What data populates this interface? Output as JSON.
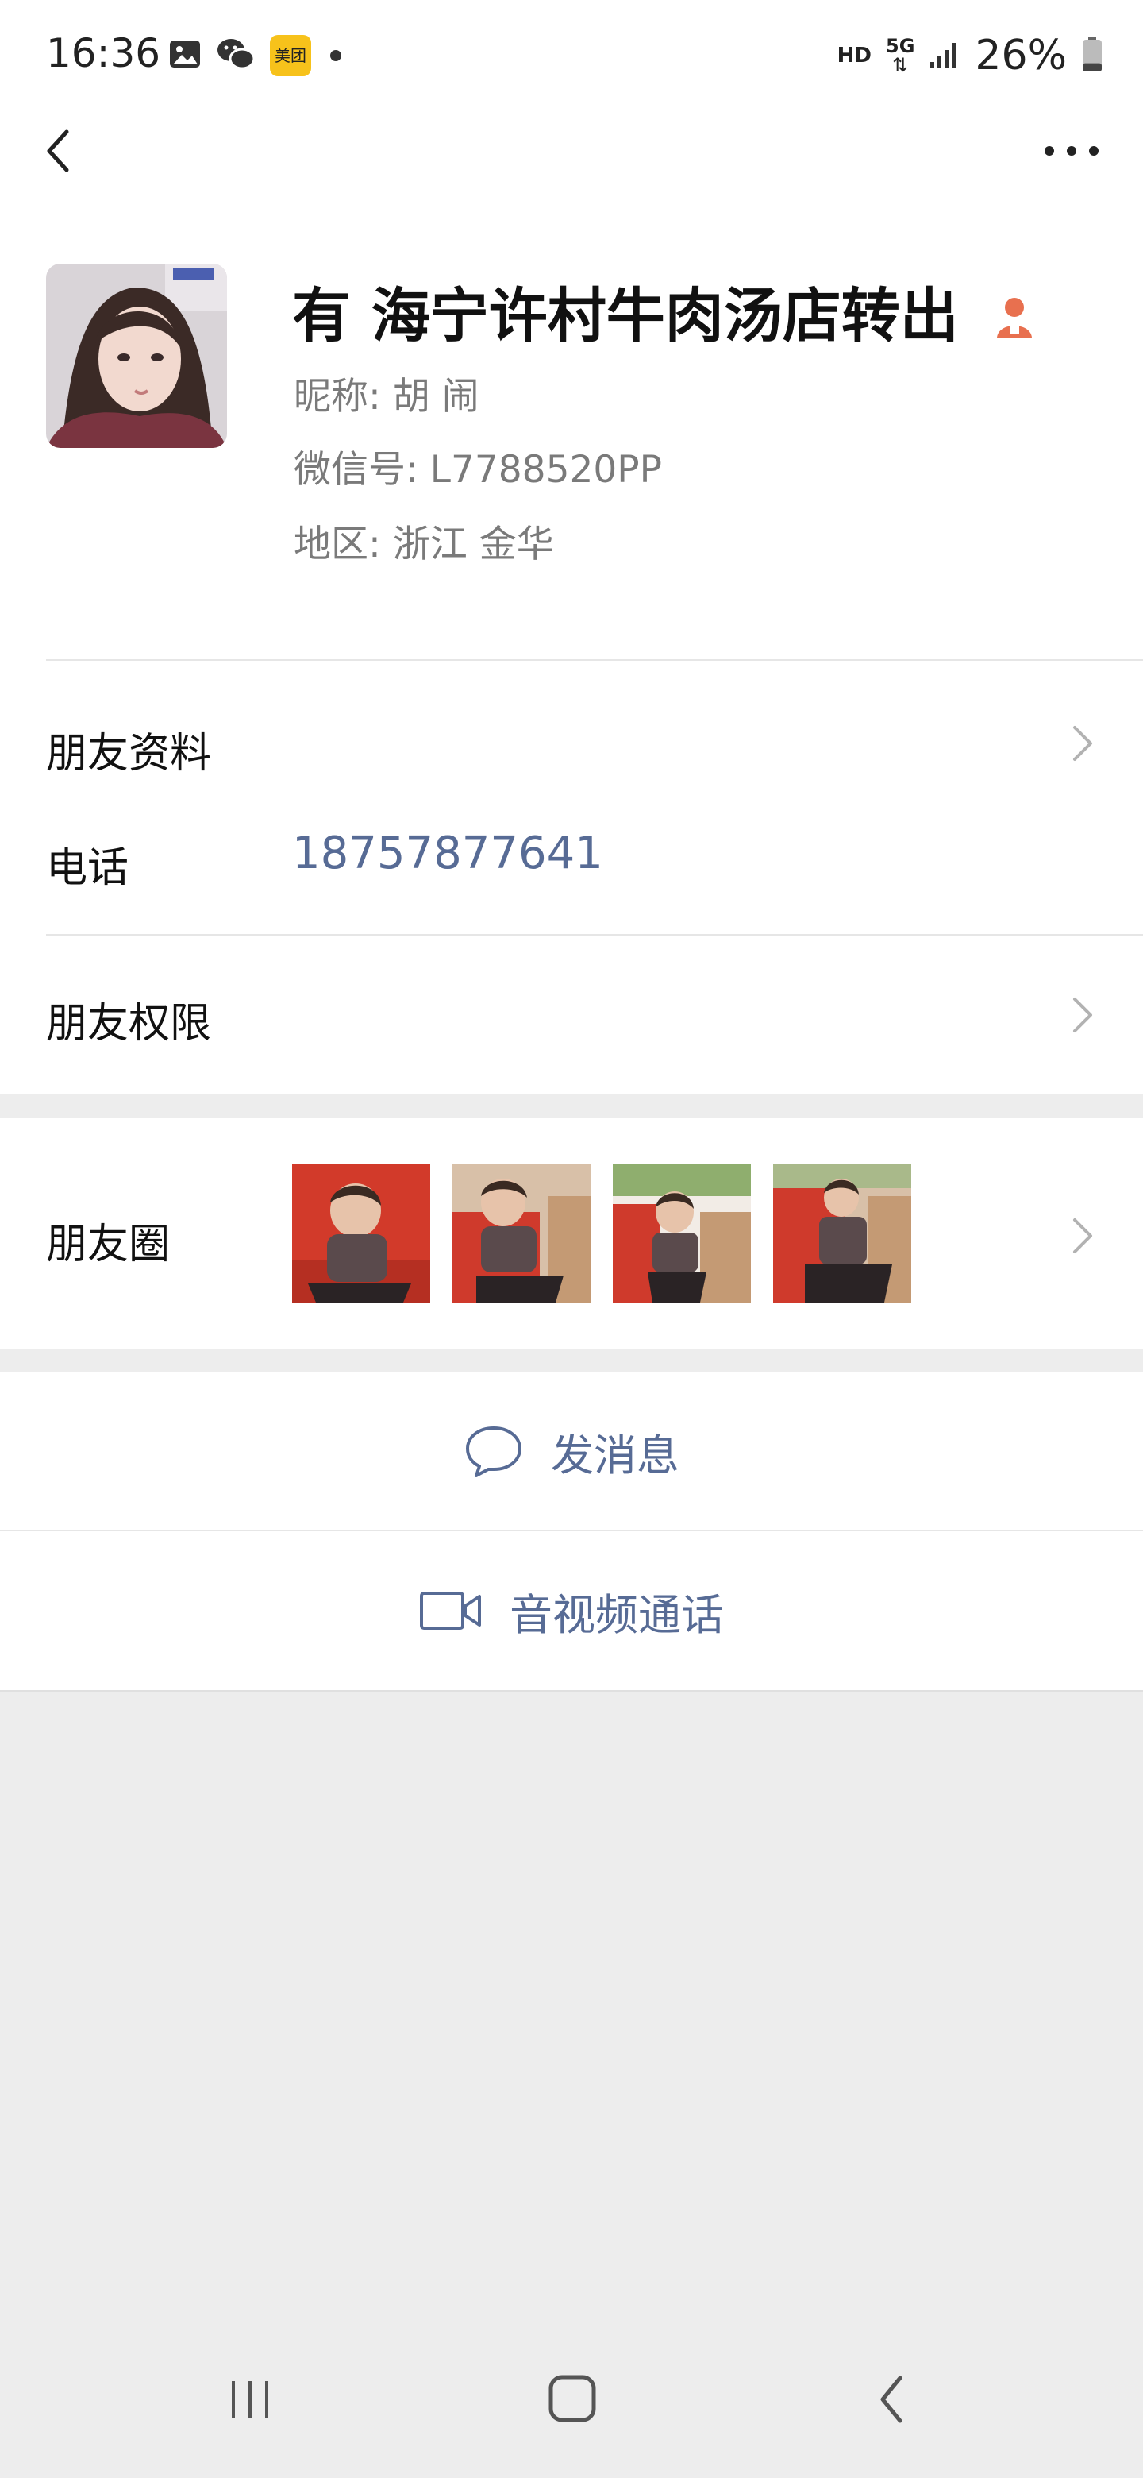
{
  "status_bar": {
    "time": "16:36",
    "left_icons": [
      "gallery-icon",
      "wechat-icon",
      "meituan-icon",
      "dot-icon"
    ],
    "meituan_label": "美团",
    "hd_label": "HD",
    "network_label": "5G",
    "battery_percent": "26%",
    "battery_level": 0.26
  },
  "header": {
    "back_icon": "chevron-left-icon",
    "more_icon": "more-dots-icon"
  },
  "profile": {
    "name": "有 海宁许村牛肉汤店转出",
    "nickname": "昵称: 胡 闹",
    "wechat_id": "微信号: L7788520PP",
    "region": "地区: 浙江  金华",
    "badge_icon": "user-tag-icon"
  },
  "info_rows": {
    "friend_profile_label": "朋友资料",
    "phone_label": "电话",
    "phone_value": "18757877641",
    "permissions_label": "朋友权限"
  },
  "moments": {
    "label": "朋友圈",
    "photo_count": 4
  },
  "actions": {
    "message_label": "发消息",
    "call_label": "音视频通话"
  },
  "colors": {
    "link_blue": "#576b95",
    "badge_orange": "#e8704f",
    "background": "#ededed"
  }
}
